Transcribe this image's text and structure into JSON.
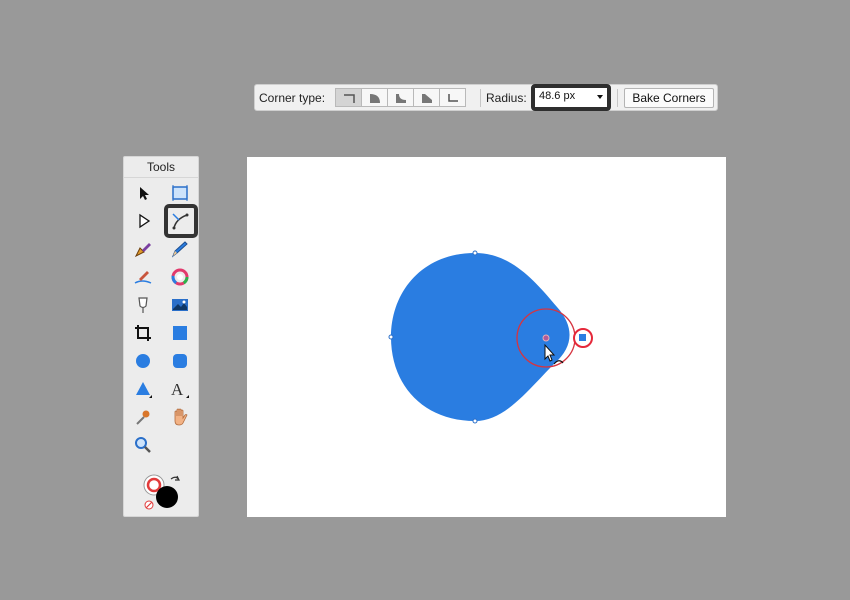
{
  "context_toolbar": {
    "corner_type_label": "Corner type:",
    "corner_types": [
      "none",
      "rounded",
      "concave",
      "straight",
      "inverted"
    ],
    "selected_corner_type": "none",
    "radius_label": "Radius:",
    "radius_value": "48.6 px",
    "bake_label": "Bake Corners"
  },
  "tools_panel": {
    "title": "Tools",
    "tools": [
      "move-tool-icon",
      "artboard-tool-icon",
      "node-tool-icon",
      "corner-tool-icon",
      "pen-tool-icon",
      "pencil-tool-icon",
      "vector-brush-tool-icon",
      "fill-tool-icon",
      "transparency-tool-icon",
      "place-image-tool-icon",
      "crop-tool-icon",
      "rectangle-tool-icon",
      "ellipse-tool-icon",
      "rounded-rectangle-tool-icon",
      "triangle-tool-icon",
      "artistic-text-tool-icon",
      "color-picker-tool-icon",
      "view-tool-icon",
      "zoom-tool-icon"
    ],
    "active_tool": "corner-tool-icon",
    "fill_color": "#ffffff",
    "stroke_color": "#000000"
  },
  "canvas": {
    "background": "#ffffff",
    "shape_color": "#2a7de1",
    "handle_color": "#e5283a"
  }
}
